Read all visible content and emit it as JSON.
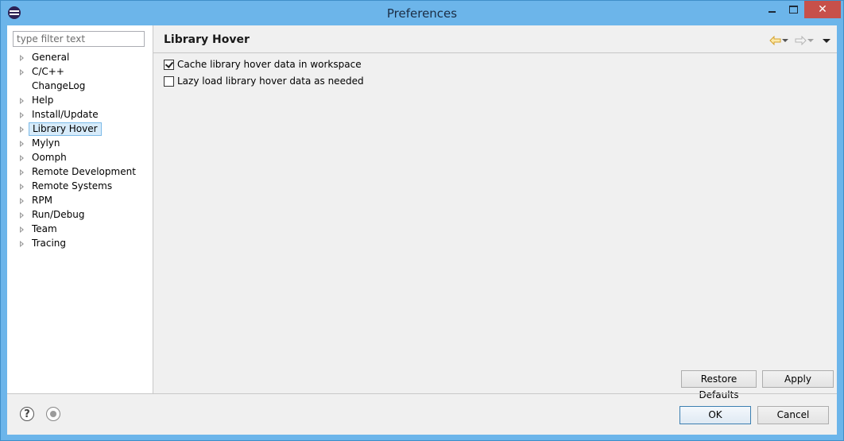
{
  "window": {
    "title": "Preferences",
    "close_glyph": "✕"
  },
  "filter": {
    "placeholder": "type filter text",
    "value": ""
  },
  "tree": {
    "items": [
      {
        "label": "General",
        "expandable": true,
        "selected": false
      },
      {
        "label": "C/C++",
        "expandable": true,
        "selected": false
      },
      {
        "label": "ChangeLog",
        "expandable": false,
        "selected": false
      },
      {
        "label": "Help",
        "expandable": true,
        "selected": false
      },
      {
        "label": "Install/Update",
        "expandable": true,
        "selected": false
      },
      {
        "label": "Library Hover",
        "expandable": true,
        "selected": true
      },
      {
        "label": "Mylyn",
        "expandable": true,
        "selected": false
      },
      {
        "label": "Oomph",
        "expandable": true,
        "selected": false
      },
      {
        "label": "Remote Development",
        "expandable": true,
        "selected": false
      },
      {
        "label": "Remote Systems",
        "expandable": true,
        "selected": false
      },
      {
        "label": "RPM",
        "expandable": true,
        "selected": false
      },
      {
        "label": "Run/Debug",
        "expandable": true,
        "selected": false
      },
      {
        "label": "Team",
        "expandable": true,
        "selected": false
      },
      {
        "label": "Tracing",
        "expandable": true,
        "selected": false
      }
    ]
  },
  "page": {
    "title": "Library Hover",
    "options": [
      {
        "label": "Cache library hover data in workspace",
        "checked": true
      },
      {
        "label": "Lazy load library hover data as needed",
        "checked": false
      }
    ],
    "restore_defaults_label": "Restore Defaults",
    "apply_label": "Apply"
  },
  "footer": {
    "help_glyph": "?",
    "ok_label": "OK",
    "cancel_label": "Cancel"
  },
  "colors": {
    "selection_bg": "#d7ebfa",
    "selection_border": "#7dbbe8",
    "nav_back_arrow": "#e8b84a",
    "close_button": "#c7504a"
  }
}
